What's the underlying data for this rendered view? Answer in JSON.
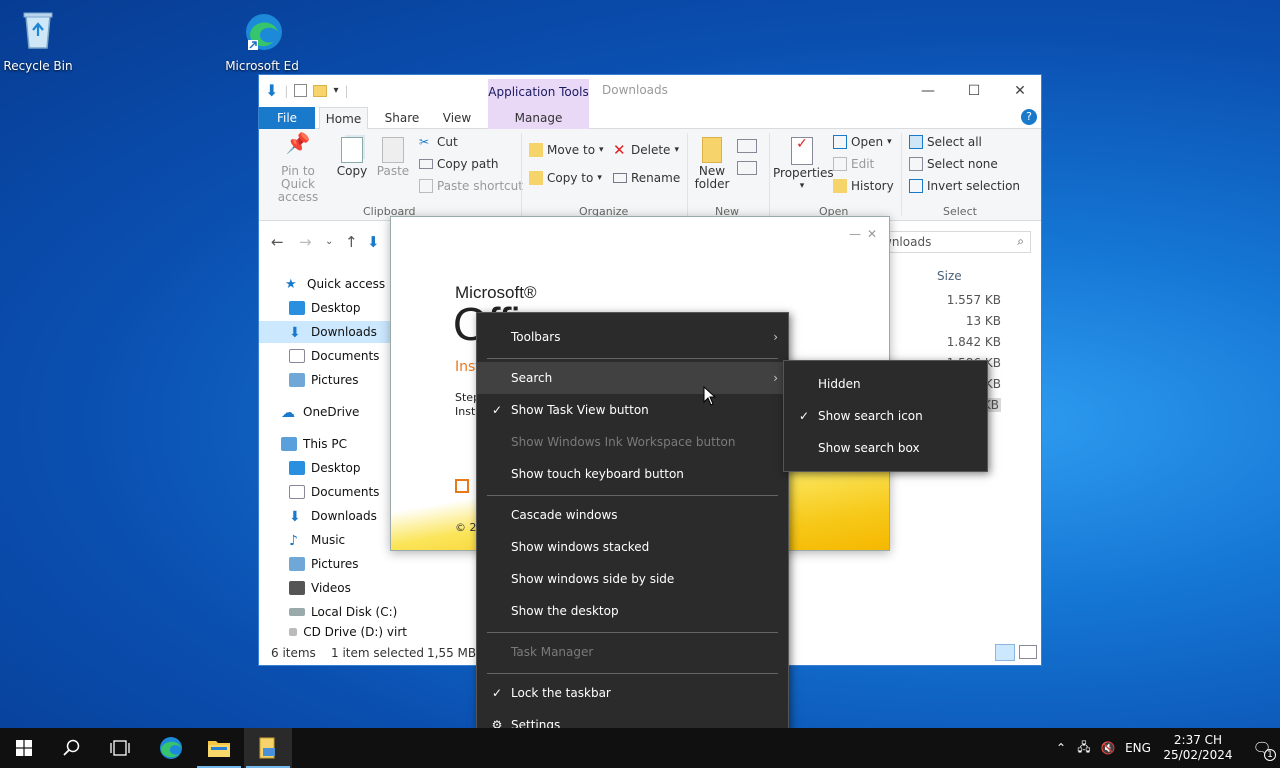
{
  "desktop": {
    "icons": [
      {
        "label": "Recycle Bin"
      },
      {
        "label": "Microsoft Ed"
      }
    ]
  },
  "explorer": {
    "ribbon_tabs": {
      "file": "File",
      "home": "Home",
      "share": "Share",
      "view": "View",
      "contextual_group": "Application Tools",
      "manage": "Manage"
    },
    "title": "Downloads",
    "window_controls": {
      "minimize": "—",
      "maximize": "☐",
      "close": "✕"
    },
    "ribbon": {
      "clipboard": {
        "pin": "Pin to Quick access",
        "copy": "Copy",
        "paste": "Paste",
        "cut": "Cut",
        "copy_path": "Copy path",
        "paste_shortcut": "Paste shortcut",
        "label": "Clipboard"
      },
      "organize": {
        "move_to": "Move to",
        "copy_to": "Copy to",
        "delete": "Delete",
        "rename": "Rename",
        "label": "Organize"
      },
      "new": {
        "new_folder": "New folder",
        "label": "New"
      },
      "open": {
        "properties": "Properties",
        "open": "Open",
        "edit": "Edit",
        "history": "History",
        "label": "Open"
      },
      "select": {
        "select_all": "Select all",
        "select_none": "Select none",
        "invert": "Invert selection",
        "label": "Select"
      }
    },
    "search_placeholder": "wnloads",
    "nav": {
      "quick_access": "Quick access",
      "desktop": "Desktop",
      "downloads": "Downloads",
      "documents": "Documents",
      "pictures": "Pictures",
      "onedrive": "OneDrive",
      "this_pc": "This PC",
      "pc_desktop": "Desktop",
      "pc_documents": "Documents",
      "pc_downloads": "Downloads",
      "pc_music": "Music",
      "pc_pictures": "Pictures",
      "pc_videos": "Videos",
      "local_disk": "Local Disk (C:)",
      "cd_drive": "CD Drive (D:) virt"
    },
    "columns": {
      "size": "Size"
    },
    "sizes": [
      "1.557 KB",
      "13 KB",
      "1.842 KB",
      "1.586 KB",
      "KB",
      "KB"
    ],
    "status": {
      "items": "6 items",
      "selected": "1 item selected",
      "size": "1,55 MB"
    }
  },
  "office_installer": {
    "brand_top": "Microsoft®",
    "brand_main": "Offi",
    "subtitle": "Inst",
    "step_line1": "Step",
    "step_line2": "Insta",
    "copyright": "© 2"
  },
  "context_menu": {
    "items": [
      {
        "label": "Toolbars",
        "arrow": "›"
      },
      {
        "label": "Search",
        "arrow": "›"
      },
      {
        "label": "Show Task View button",
        "check": "✓"
      },
      {
        "label": "Show Windows Ink Workspace button"
      },
      {
        "label": "Show touch keyboard button"
      },
      {
        "label": "Cascade windows"
      },
      {
        "label": "Show windows stacked"
      },
      {
        "label": "Show windows side by side"
      },
      {
        "label": "Show the desktop"
      },
      {
        "label": "Task Manager"
      },
      {
        "label": "Lock the taskbar",
        "check": "✓"
      },
      {
        "label": "Settings",
        "icon": "gear-icon"
      }
    ]
  },
  "search_submenu": {
    "items": [
      {
        "label": "Hidden"
      },
      {
        "label": "Show search icon",
        "check": "✓"
      },
      {
        "label": "Show search box"
      }
    ]
  },
  "taskbar": {
    "tray": {
      "language": "ENG",
      "time": "2:37 CH",
      "date": "25/02/2024",
      "notifications": "1"
    }
  },
  "colors": {
    "accent": "#1979ca",
    "menu_bg": "#2b2b2b",
    "taskbar_bg": "#101010",
    "selection": "#cce8ff",
    "office_orange": "#e9781a"
  }
}
